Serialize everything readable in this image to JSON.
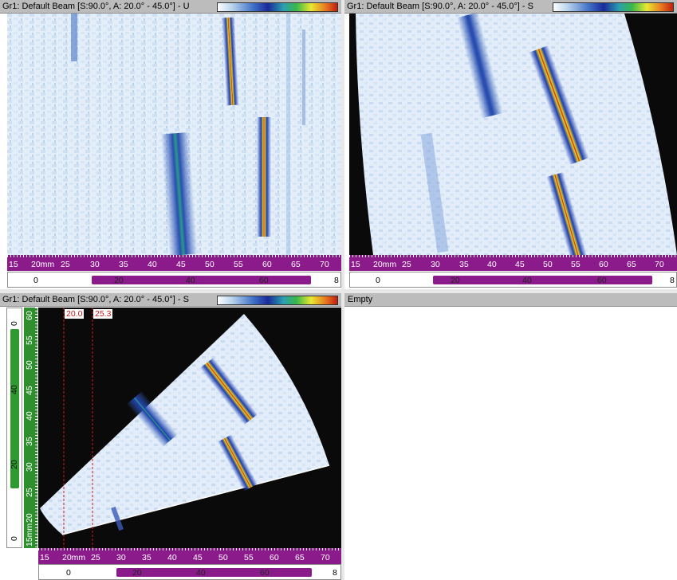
{
  "views": {
    "top_left": {
      "title": "Gr1: Default Beam [S:90.0°, A: 20.0° - 45.0°] - U",
      "ruler": [
        "15",
        "20mm",
        "25",
        "30",
        "35",
        "40",
        "45",
        "50",
        "55",
        "60",
        "65",
        "70"
      ],
      "scroll": {
        "start": "0",
        "labels": [
          "20",
          "40",
          "60"
        ],
        "end": "8"
      }
    },
    "top_right": {
      "title": "Gr1: Default Beam [S:90.0°, A: 20.0° - 45.0°] - S",
      "ruler": [
        "15",
        "20mm",
        "25",
        "30",
        "35",
        "40",
        "45",
        "50",
        "55",
        "60",
        "65",
        "70"
      ],
      "scroll": {
        "start": "0",
        "labels": [
          "20",
          "40",
          "60"
        ],
        "end": "8"
      }
    },
    "bottom_left": {
      "title": "Gr1: Default Beam [S:90.0°, A: 20.0° - 45.0°] - S",
      "cursor1": "20.0",
      "cursor2": "25.3",
      "ruler": [
        "15",
        "20mm",
        "25",
        "30",
        "35",
        "40",
        "45",
        "50",
        "55",
        "60",
        "65",
        "70"
      ],
      "scroll": {
        "start": "0",
        "labels": [
          "20",
          "40",
          "60"
        ],
        "end": "8"
      },
      "vruler": [
        "60",
        "55",
        "50",
        "45",
        "40",
        "35",
        "30",
        "25",
        "20",
        "15mm"
      ],
      "vscroll": [
        "0",
        "40",
        "20",
        "0"
      ]
    },
    "bottom_right": {
      "title": "Empty"
    }
  },
  "colors": {
    "ruler_purple": "#8b1a8b",
    "ruler_green": "#2f8f2f",
    "cursor_red": "#d01818",
    "background_black": "#0a0a0a",
    "titlebar_gray": "#bcbcbc"
  }
}
